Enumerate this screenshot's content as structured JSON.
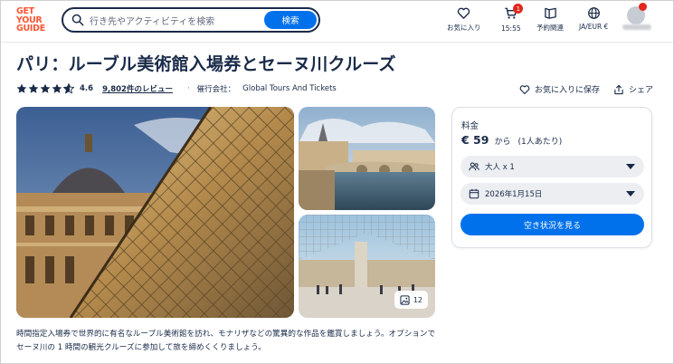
{
  "header": {
    "logo_lines": [
      "GET",
      "YOUR",
      "GUIDE"
    ],
    "search_placeholder": "行き先やアクティビティを検索",
    "search_button": "検索",
    "nav": [
      {
        "icon": "heart-icon",
        "label": "お気に入り"
      },
      {
        "icon": "cart-icon",
        "label": "15:55",
        "badge": "1"
      },
      {
        "icon": "bookmark-icon",
        "label": "予約関連"
      },
      {
        "icon": "globe-icon",
        "label": "JA/EUR €"
      },
      {
        "icon": "avatar-icon",
        "label": ""
      }
    ]
  },
  "title": "パリ：ルーブル美術館入場券とセーヌ川クルーズ",
  "meta": {
    "stars": 4.6,
    "rating": "4.6",
    "reviews": "9,802件のレビュー",
    "separator": "·",
    "operator_label": "催行会社：",
    "operator": "Global Tours And Tickets",
    "wishlist": "お気に入りに保存",
    "share": "シェア"
  },
  "gallery": {
    "photo_count": "12"
  },
  "booking": {
    "price_label": "料金",
    "price": "€ 59",
    "price_from": "から",
    "price_per": "(1人あたり)",
    "participants": "大人 x 1",
    "date": "2026年1月15日",
    "cta": "空き状況を見る"
  },
  "description": "時間指定入場券で世界的に有名なルーブル美術館を訪れ、モナリザなどの驚異的な作品を鑑賞しましょう。オプションでセーヌ川の 1 時間の観光クルーズに参加して旅を締めくくりましょう。",
  "colors": {
    "brand": "#ff5533",
    "primary": "#0071eb",
    "text": "#1a2b49",
    "badge": "#e0281b"
  }
}
